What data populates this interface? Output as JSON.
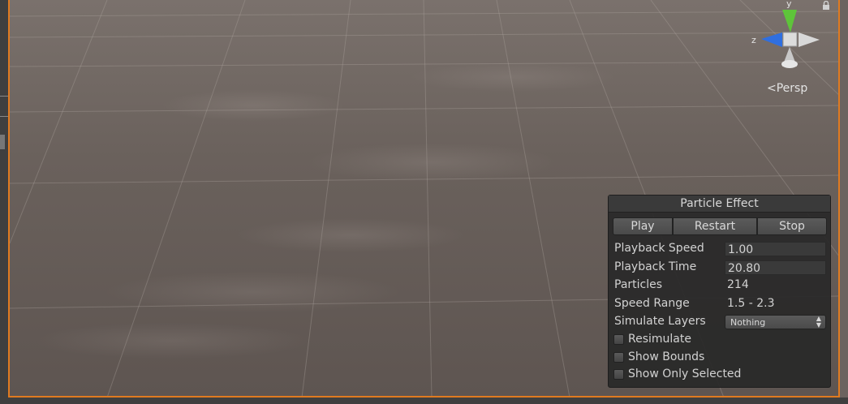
{
  "scene_view": {
    "projection_label": "Persp",
    "gizmo": {
      "y_label": "y",
      "z_label": "z"
    }
  },
  "particle_panel": {
    "title": "Particle Effect",
    "buttons": {
      "play": "Play",
      "restart": "Restart",
      "stop": "Stop"
    },
    "playback_speed": {
      "label": "Playback Speed",
      "value": "1.00"
    },
    "playback_time": {
      "label": "Playback Time",
      "value": "20.80"
    },
    "particles": {
      "label": "Particles",
      "value": "214"
    },
    "speed_range": {
      "label": "Speed Range",
      "value": "1.5 - 2.3"
    },
    "simulate_layers": {
      "label": "Simulate Layers",
      "selected": "Nothing"
    },
    "checkboxes": {
      "resimulate": "Resimulate",
      "show_bounds": "Show Bounds",
      "show_only_selected": "Show Only Selected"
    }
  },
  "colors": {
    "accent_border": "#e07a20",
    "gizmo_y": "#5ec43a",
    "gizmo_z": "#2f6fe0",
    "gizmo_x_cone": "#c8c8c8"
  }
}
